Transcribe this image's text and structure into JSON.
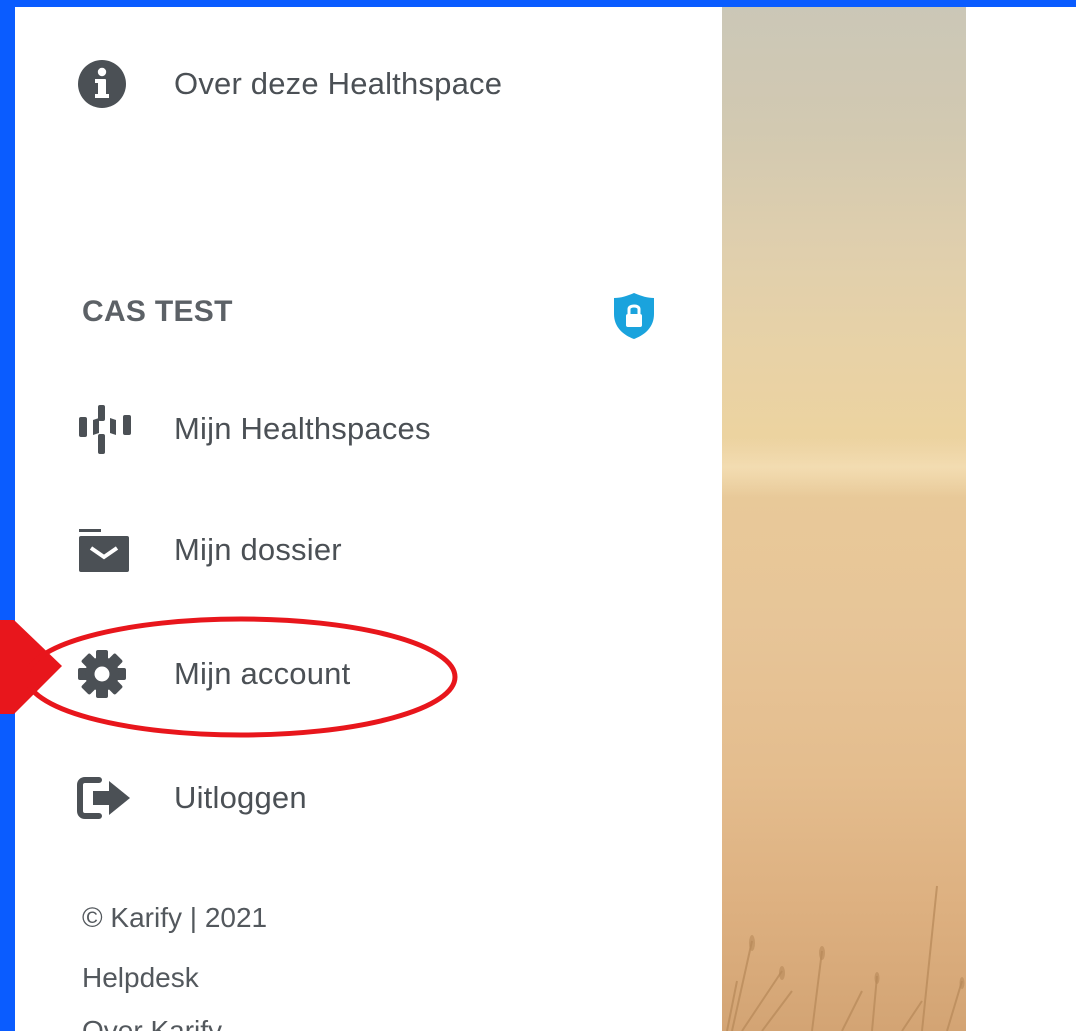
{
  "menu": {
    "about_label": "Over deze Healthspace",
    "section_title": "CAS TEST",
    "items": [
      {
        "label": "Mijn Healthspaces",
        "icon": "healthspaces-icon"
      },
      {
        "label": "Mijn dossier",
        "icon": "folder-icon"
      },
      {
        "label": "Mijn account",
        "icon": "gear-icon"
      },
      {
        "label": "Uitloggen",
        "icon": "logout-icon"
      }
    ]
  },
  "footer": {
    "copyright": "© Karify | 2021",
    "helpdesk": "Helpdesk",
    "about": "Over Karify"
  },
  "colors": {
    "frame": "#0a5cff",
    "text": "#4b5055",
    "shield": "#1aa3dd",
    "highlight": "#e8161c"
  }
}
